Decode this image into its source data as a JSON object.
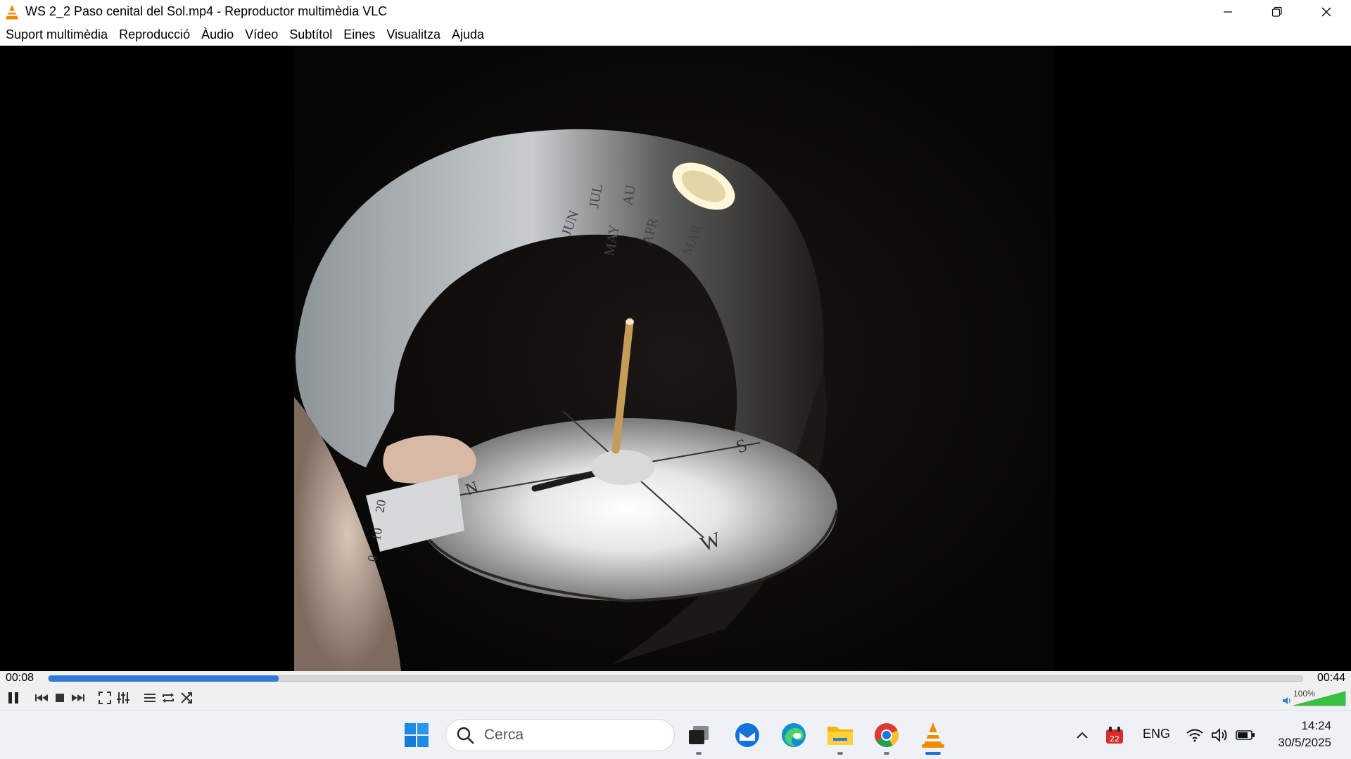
{
  "window": {
    "title": "WS 2_2 Paso cenital del Sol.mp4 - Reproductor multimèdia VLC",
    "icon": "vlc-cone-icon",
    "controls": [
      "minimize-icon",
      "restore-icon",
      "close-icon"
    ]
  },
  "menu": {
    "items": [
      "Suport multimèdia",
      "Reproducció",
      "Àudio",
      "Vídeo",
      "Subtítol",
      "Eines",
      "Visualitza",
      "Ajuda"
    ]
  },
  "video_overlay": {
    "months_upper": [
      "JUN",
      "JUL",
      "MAY",
      "AU",
      "APR",
      "MAR"
    ],
    "compass": [
      "S",
      "W",
      "N"
    ],
    "side_scale": [
      "20",
      "10",
      "0"
    ]
  },
  "playback": {
    "elapsed": "00:08",
    "total": "00:44",
    "progress_fraction": 0.1836,
    "volume_label": "100%",
    "volume_fraction": 1.0,
    "accent": "#2f78d4"
  },
  "taskbar": {
    "search_placeholder": "Cerca",
    "language": "ENG",
    "time": "14:24",
    "date": "30/5/2025",
    "calendar_badge": "22",
    "apps": [
      "windows-start-icon",
      "task-view-icon",
      "thunderbird-icon",
      "edge-icon",
      "file-explorer-icon",
      "chrome-icon",
      "vlc-icon"
    ]
  }
}
